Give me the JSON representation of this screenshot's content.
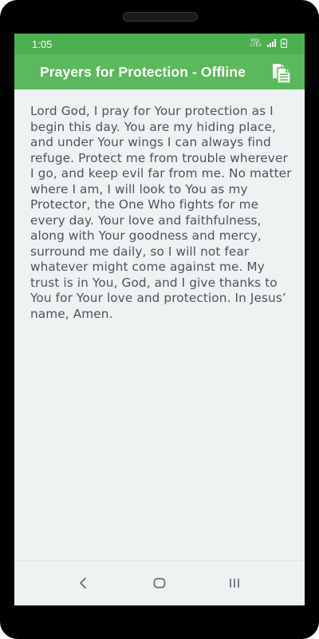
{
  "status_bar": {
    "time": "1:05",
    "volte_label": "Vo)) LTE1"
  },
  "app_bar": {
    "title": "Prayers for Protection - Offline",
    "copy_icon": "copy-icon"
  },
  "prayer": {
    "text": "Lord God, I pray for Your protection as I begin this day. You are my hiding place, and under Your wings I can always find refuge. Protect me from trouble wherever I go, and keep evil far from me. No matter where I am, I will look to You as my Protector, the One Who fights for me every day. Your love and faithfulness, along with Your goodness and mercy, surround me daily, so I will not fear whatever might come against me. My trust is in You, God, and I give thanks to You for Your love and protection. In Jesus’ name, Amen."
  },
  "nav": {
    "back_icon": "back-icon",
    "home_icon": "home-icon",
    "recents_icon": "recents-icon"
  },
  "colors": {
    "status_bar": "#4caf50",
    "app_bar": "#5cb85c",
    "background": "#eef2f3",
    "text": "#505458"
  }
}
